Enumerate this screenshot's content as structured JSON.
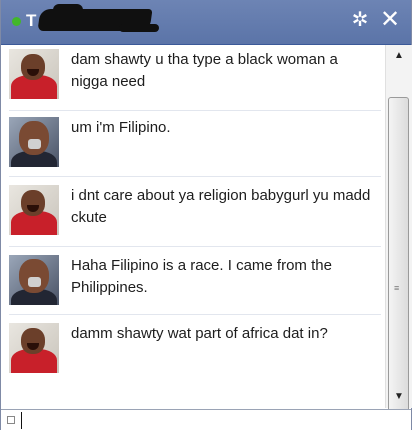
{
  "header": {
    "title": "T",
    "status": "online",
    "settings_icon": "gear-icon",
    "close_icon": "close-icon",
    "settings_glyph": "✲",
    "close_glyph": "✕"
  },
  "messages": [
    {
      "avatar": "user-avatar-red",
      "text": "dam shawty u tha type a black woman a nigga need"
    },
    {
      "avatar": "user-avatar-dark",
      "text": "um i'm Filipino."
    },
    {
      "avatar": "user-avatar-red",
      "text": "i dnt care about ya religion babygurl yu madd ckute"
    },
    {
      "avatar": "user-avatar-dark",
      "text": "Haha Filipino is a race. I came from the Philippines."
    },
    {
      "avatar": "user-avatar-red",
      "text": "damm shawty wat part of africa dat in?"
    }
  ],
  "scrollbar": {
    "up": "▲",
    "down": "▼",
    "grip": "≡"
  },
  "composer": {
    "value": "",
    "placeholder": ""
  },
  "colors": {
    "titlebar": "#6d84b4",
    "status": "#42b72a",
    "text": "#1d1d1d"
  }
}
